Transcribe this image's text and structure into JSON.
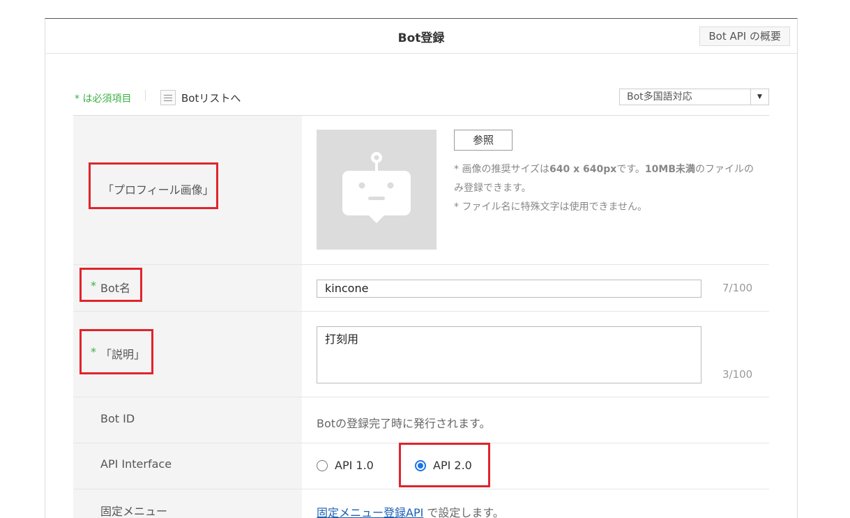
{
  "header": {
    "title": "Bot登録",
    "api_overview_label": "Bot API の概要"
  },
  "subbar": {
    "required_note": "* は必須項目",
    "bot_list_link": "Botリストへ",
    "language_select_value": "Bot多国語対応"
  },
  "form": {
    "profile_image": {
      "label": "「プロフィール画像」",
      "browse_label": "参照",
      "hint_line1_prefix": "* 画像の推奨サイズは",
      "hint_size": "640 x 640px",
      "hint_line1_mid": "です。",
      "hint_limit": "10MB未満",
      "hint_line1_suffix": "のファイルのみ登録できます。",
      "hint_line2": "* ファイル名に特殊文字は使用できません。"
    },
    "bot_name": {
      "required_mark": "*",
      "label": "Bot名",
      "value": "kincone",
      "counter": "7/100"
    },
    "description": {
      "required_mark": "*",
      "label": "「説明」",
      "value": "打刻用",
      "counter": "3/100"
    },
    "bot_id": {
      "label": "Bot ID",
      "value": "Botの登録完了時に発行されます。"
    },
    "api_interface": {
      "label": "API Interface",
      "options": [
        {
          "label": "API 1.0",
          "selected": false
        },
        {
          "label": "API 2.0",
          "selected": true
        }
      ]
    },
    "fixed_menu": {
      "label": "固定メニュー",
      "link_text": "固定メニュー登録API",
      "suffix": " で設定します。"
    }
  },
  "colors": {
    "highlight": "#e0242b",
    "required": "#3cb043",
    "radio_selected": "#1a73e8",
    "link": "#1a5fb4"
  }
}
